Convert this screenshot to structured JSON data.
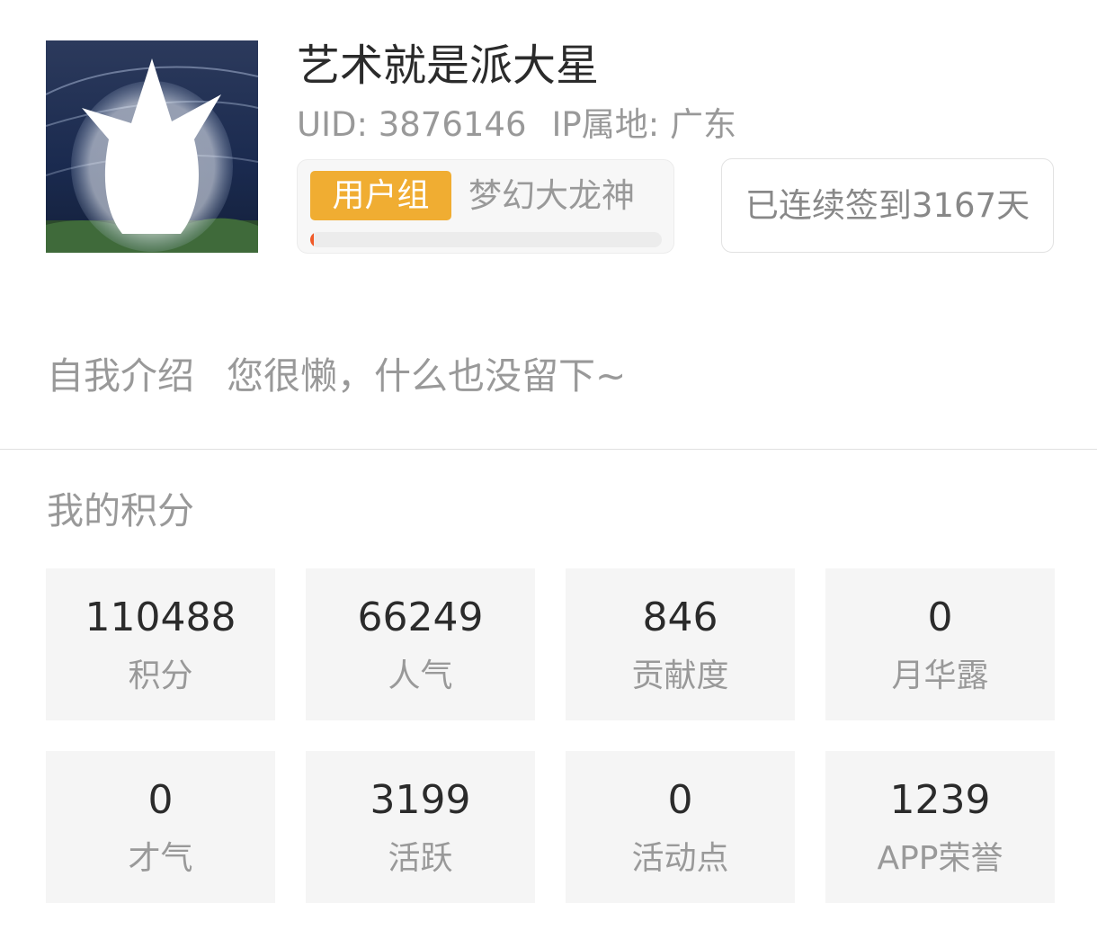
{
  "profile": {
    "username": "艺术就是派大星",
    "uid": "UID: 3876146",
    "ip": "IP属地: 广东",
    "group_tag": "用户组",
    "group_name": "梦幻大龙神",
    "group_progress": 0.01,
    "signin": "已连续签到3167天"
  },
  "intro": {
    "label": "自我介绍",
    "text": "您很懒，什么也没留下~"
  },
  "points": {
    "title": "我的积分",
    "stats": [
      {
        "value": "110488",
        "label": "积分"
      },
      {
        "value": "66249",
        "label": "人气"
      },
      {
        "value": "846",
        "label": "贡献度"
      },
      {
        "value": "0",
        "label": "月华露"
      },
      {
        "value": "0",
        "label": "才气"
      },
      {
        "value": "3199",
        "label": "活跃"
      },
      {
        "value": "0",
        "label": "活动点"
      },
      {
        "value": "1239",
        "label": "APP荣誉"
      }
    ]
  },
  "colors": {
    "tag_bg": "#f0ad32",
    "progress_fill": "#f05a28",
    "card_bg": "#f5f5f5"
  }
}
